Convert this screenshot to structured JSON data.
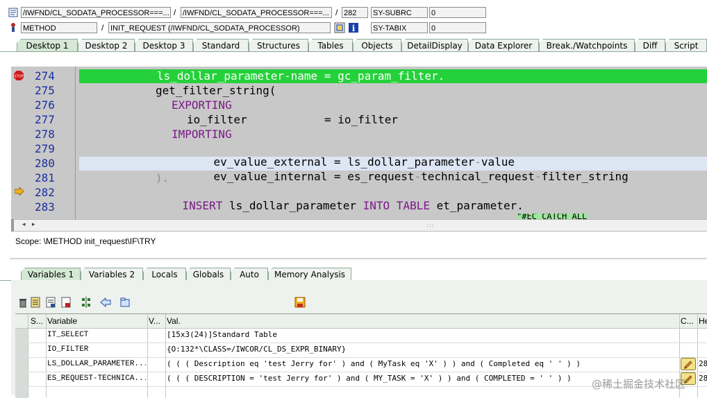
{
  "header": {
    "row1": {
      "program": "/IWFND/CL_SODATA_PROCESSOR===...",
      "include": "/IWFND/CL_SODATA_PROCESSOR===...",
      "line": "282",
      "sysvar_name": "SY-SUBRC",
      "sysvar_value": "0"
    },
    "row2": {
      "type": "METHOD",
      "event": "INIT_REQUEST (/IWFND/CL_SODATA_PROCESSOR)",
      "sysvar_name": "SY-TABIX",
      "sysvar_value": "0"
    }
  },
  "desktop_tabs": [
    "Desktop 1",
    "Desktop 2",
    "Desktop 3",
    "Standard",
    "Structures",
    "Tables",
    "Objects",
    "DetailDisplay",
    "Data Explorer",
    "Break./Watchpoints",
    "Diff",
    "Script"
  ],
  "editor": {
    "line_numbers": [
      "274",
      "275",
      "276",
      "277",
      "278",
      "279",
      "280",
      "281",
      "282",
      "283"
    ],
    "code": [
      {
        "parts": [
          "ls_dollar_parameter-name = gc_param_filter."
        ]
      },
      {
        "parts": [
          "get_filter_string("
        ]
      },
      {
        "parts": [
          "EXPORTING"
        ]
      },
      {
        "parts": [
          "io_filter",
          "= io_filter"
        ]
      },
      {
        "parts": [
          "IMPORTING"
        ]
      },
      {
        "parts": [
          "ev_value_external = ls_dollar_parameter",
          "-",
          "value"
        ]
      },
      {
        "parts": [
          "ev_value_internal = es_request",
          "-",
          "technical_request",
          "-",
          "filter_string"
        ]
      },
      {
        "parts": [
          ")."
        ]
      },
      {
        "parts": [
          "INSERT",
          "ls_dollar_parameter",
          "INTO TABLE",
          "et_parameter."
        ]
      },
      {
        "parts": [
          ""
        ]
      }
    ],
    "cutoff_comment": "\"#EC CATCH_ALL"
  },
  "scope": "Scope: \\METHOD init_request\\IF\\TRY",
  "variable_tabs": [
    "Variables 1",
    "Variables 2",
    "Locals",
    "Globals",
    "Auto",
    "Memory Analysis"
  ],
  "grid": {
    "headers": {
      "s": "S...",
      "variable": "Variable",
      "v": "V...",
      "val": "Val.",
      "c": "C...",
      "h": "He"
    },
    "rows": [
      {
        "variable": "IT_SELECT",
        "value": "[15x3(24)]Standard Table"
      },
      {
        "variable": "IO_FILTER",
        "value": "{O:132*\\CLASS=/IWCOR/CL_DS_EXPR_BINARY}"
      },
      {
        "variable": "LS_DOLLAR_PARAMETER...",
        "value": "( ( ( Description eq 'test Jerry for' ) and ( MyTask eq 'X' ) ) and ( Completed eq ' ' ) )",
        "extra": "28"
      },
      {
        "variable": "ES_REQUEST-TECHNICA...",
        "value": "( ( ( DESCRIPTION = 'test Jerry for' ) and ( MY_TASK = 'X' ) ) and ( COMPLETED = ' ' ) )",
        "extra": "28"
      }
    ]
  },
  "watermark": "@稀土掘金技术社区",
  "colors": {
    "exec_line": "#25d13a",
    "cursor_line": "#dde6f3",
    "editor_bg": "#c8c8c8",
    "keyword": "#7a1a86",
    "line_number": "#1a2ea0"
  }
}
